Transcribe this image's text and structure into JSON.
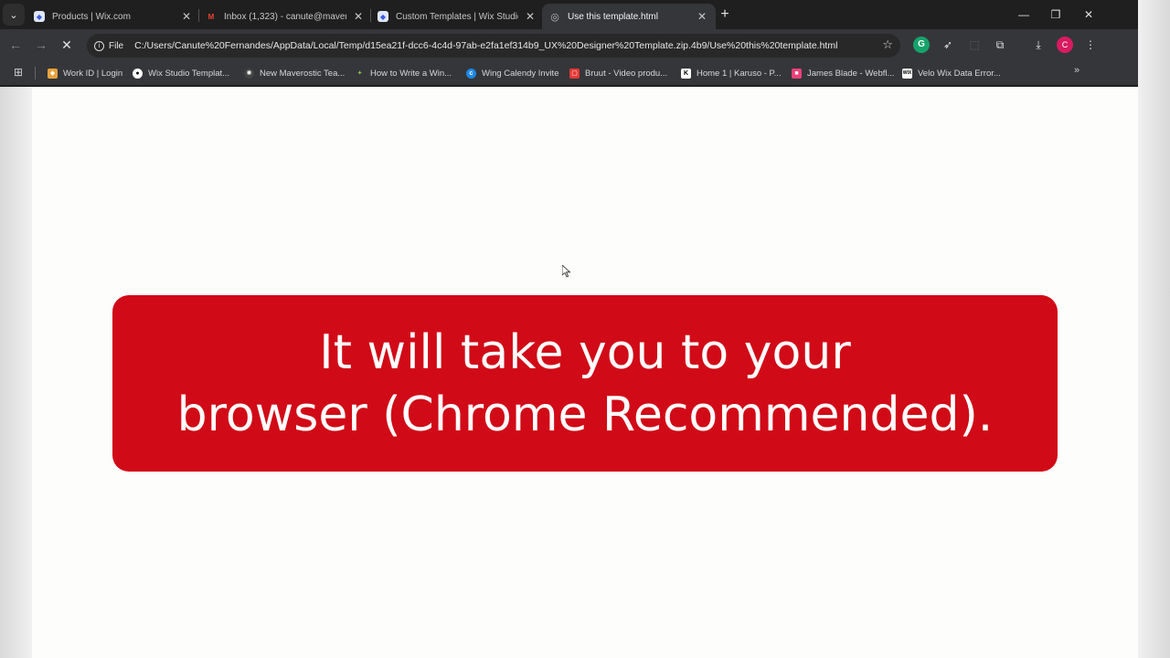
{
  "tabs": [
    {
      "title": "Products | Wix.com",
      "favicon": "wix-shield-icon",
      "active": false
    },
    {
      "title": "Inbox (1,323) - canute@mavera",
      "favicon": "gmail-icon",
      "active": false
    },
    {
      "title": "Custom Templates | Wix Studio",
      "favicon": "wix-shield-icon",
      "active": false
    },
    {
      "title": "Use this template.html",
      "favicon": "globe-icon",
      "active": true
    }
  ],
  "toolbar": {
    "scheme_label": "File",
    "url": "C:/Users/Canute%20Fernandes/AppData/Local/Temp/d15ea21f-dcc6-4c4d-97ab-e2fa1ef314b9_UX%20Designer%20Template.zip.4b9/Use%20this%20template.html",
    "profile_initial": "C"
  },
  "bookmarks": [
    {
      "label": "Work ID | Login",
      "color": "#e9a23b"
    },
    {
      "label": "Wix Studio Templat...",
      "color": "#111111"
    },
    {
      "label": "New Maverostic Tea...",
      "color": "#222222"
    },
    {
      "label": "How to Write a Win...",
      "color": "#8bc34a"
    },
    {
      "label": "Wing Calendy Invite",
      "color": "#1e88e5"
    },
    {
      "label": "Bruut - Video produ...",
      "color": "#e53935"
    },
    {
      "label": "Home 1 | Karuso - P...",
      "color": "#ffffff"
    },
    {
      "label": "James Blade - Webfl...",
      "color": "#ec407a"
    },
    {
      "label": "Velo Wix Data Error...",
      "color": "#ffffff"
    }
  ],
  "banner": {
    "line1": "It will take you to your",
    "line2": "browser (Chrome Recommended).",
    "bg_color": "#d10a17"
  }
}
